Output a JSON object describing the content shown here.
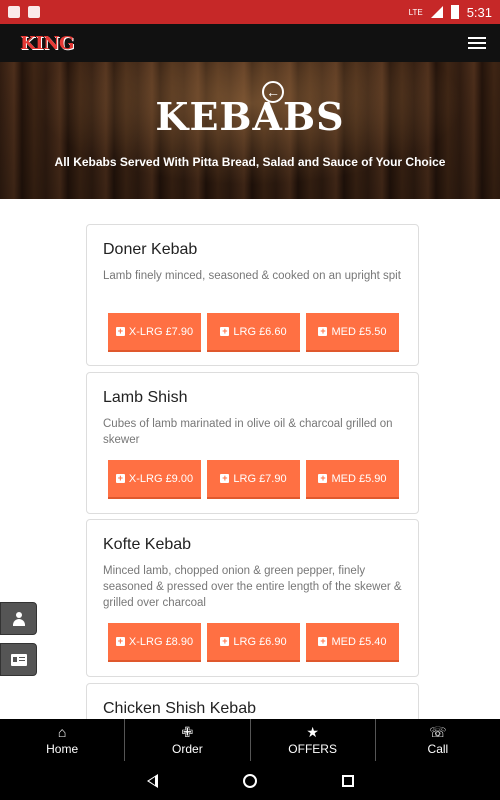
{
  "status_bar": {
    "time": "5:31",
    "network": "LTE"
  },
  "app_bar": {
    "logo_text": "KING"
  },
  "hero": {
    "title": "KEBABS",
    "subtitle": "All Kebabs Served With Pitta Bread, Salad and Sauce of Your Choice"
  },
  "items": [
    {
      "name": "Doner Kebab",
      "description": "Lamb finely minced, seasoned & cooked on an upright spit",
      "prices": [
        "X-LRG £7.90",
        "LRG £6.60",
        "MED £5.50"
      ]
    },
    {
      "name": "Lamb Shish",
      "description": "Cubes of lamb marinated in olive oil & charcoal grilled on skewer",
      "prices": [
        "X-LRG £9.00",
        "LRG £7.90",
        "MED £5.90"
      ]
    },
    {
      "name": "Kofte Kebab",
      "description": "Minced lamb, chopped onion & green pepper, finely seasoned & pressed over the entire length of the skewer & grilled over charcoal",
      "prices": [
        "X-LRG £8.90",
        "LRG £6.90",
        "MED £5.40"
      ]
    },
    {
      "name": "Chicken Shish Kebab",
      "description": "",
      "prices": []
    }
  ],
  "tabs": [
    {
      "label": "Home",
      "icon": "home-icon"
    },
    {
      "label": "Order",
      "icon": "utensils-icon"
    },
    {
      "label": "OFFERS",
      "icon": "star-icon"
    },
    {
      "label": "Call",
      "icon": "phone-icon"
    }
  ],
  "colors": {
    "status_bar": "#c62828",
    "accent": "#ff7043",
    "app_bar": "#111111",
    "logo": "#e53935"
  }
}
